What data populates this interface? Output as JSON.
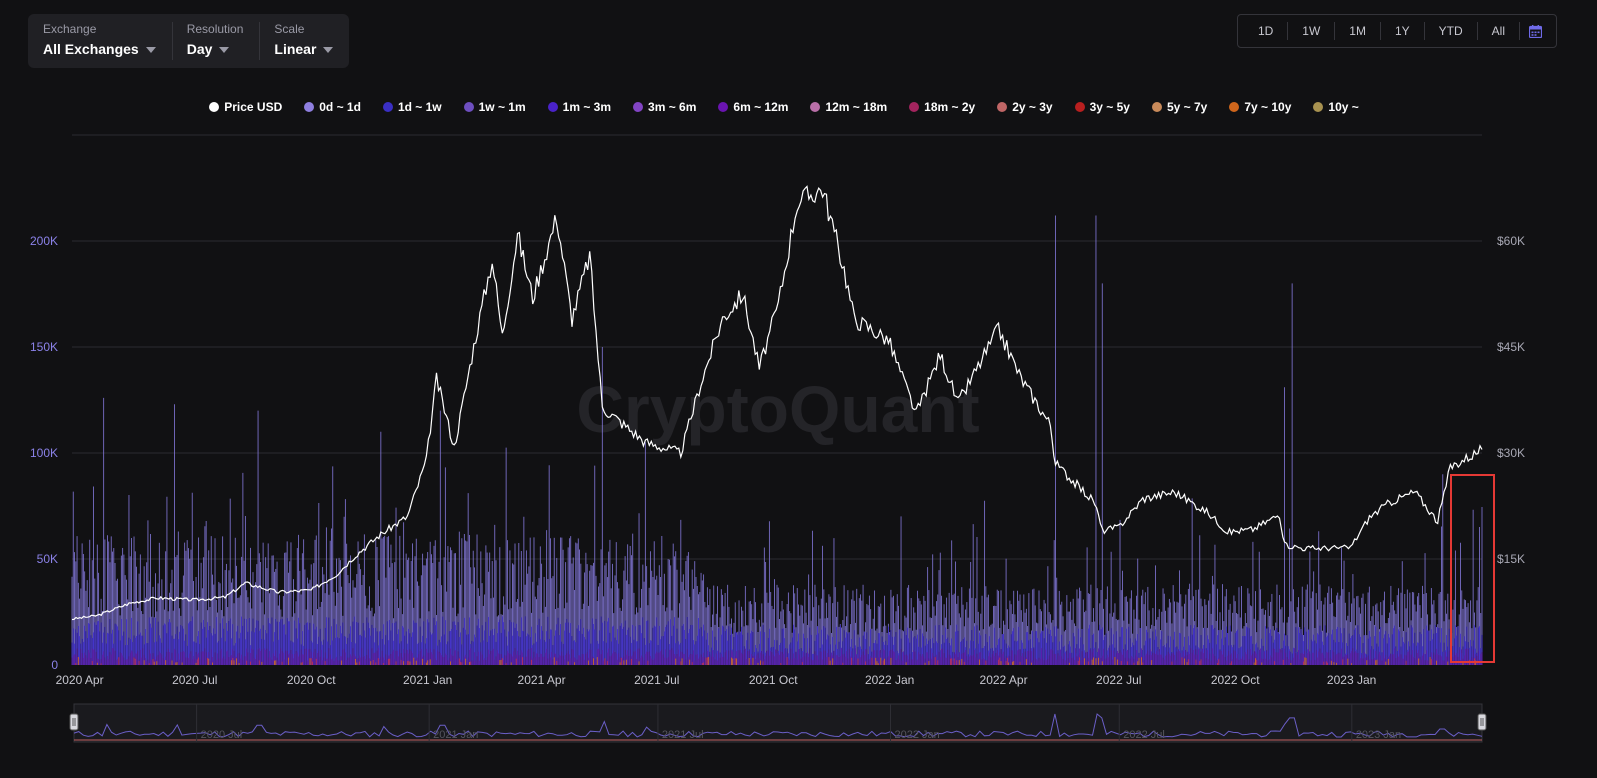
{
  "controls": {
    "exchange": {
      "label": "Exchange",
      "value": "All Exchanges"
    },
    "resolution": {
      "label": "Resolution",
      "value": "Day"
    },
    "scale": {
      "label": "Scale",
      "value": "Linear"
    }
  },
  "range_buttons": [
    "1D",
    "1W",
    "1M",
    "1Y",
    "YTD",
    "All"
  ],
  "calendar_icon": "calendar-icon",
  "watermark": "CryptoQuant",
  "colors": {
    "background": "#111113",
    "price_line": "#ffffff",
    "left_axis_text": "#8b82e8",
    "highlight_box": "#e53935"
  },
  "legend": [
    {
      "name": "Price USD",
      "color": "#ffffff"
    },
    {
      "name": "0d ~ 1d",
      "color": "#8f7fe0"
    },
    {
      "name": "1d ~ 1w",
      "color": "#3a2fc4"
    },
    {
      "name": "1w ~ 1m",
      "color": "#6e4fc0"
    },
    {
      "name": "1m ~ 3m",
      "color": "#4a22c9"
    },
    {
      "name": "3m ~ 6m",
      "color": "#8244c4"
    },
    {
      "name": "6m ~ 12m",
      "color": "#6a14b0"
    },
    {
      "name": "12m ~ 18m",
      "color": "#b96fa8"
    },
    {
      "name": "18m ~ 2y",
      "color": "#a3245e"
    },
    {
      "name": "2y ~ 3y",
      "color": "#c06666"
    },
    {
      "name": "3y ~ 5y",
      "color": "#b81f1f"
    },
    {
      "name": "5y ~ 7y",
      "color": "#c88a5a"
    },
    {
      "name": "7y ~ 10y",
      "color": "#d0661c"
    },
    {
      "name": "10y ~",
      "color": "#a89250"
    }
  ],
  "chart_data": {
    "type": "bar",
    "title": "",
    "x_tick_labels": [
      "2020 Apr",
      "2020 Jul",
      "2020 Oct",
      "2021 Jan",
      "2021 Apr",
      "2021 Jul",
      "2021 Oct",
      "2022 Jan",
      "2022 Apr",
      "2022 Jul",
      "2022 Oct",
      "2023 Jan"
    ],
    "xlim": [
      "2020-03-26",
      "2023-04-14"
    ],
    "left_axis": {
      "ticks": [
        "0",
        "50K",
        "100K",
        "150K",
        "200K"
      ],
      "ylim": [
        0,
        250000
      ]
    },
    "right_axis": {
      "ticks": [
        "$15K",
        "$30K",
        "$45K",
        "$60K"
      ],
      "ylim": [
        0,
        75000
      ]
    },
    "grid": true,
    "legend_position": "top-center",
    "price_usd": {
      "name": "Price USD",
      "points": [
        [
          "2020-03-26",
          6500
        ],
        [
          "2020-04-15",
          7000
        ],
        [
          "2020-05-10",
          8700
        ],
        [
          "2020-06-01",
          9500
        ],
        [
          "2020-07-01",
          9200
        ],
        [
          "2020-07-25",
          9600
        ],
        [
          "2020-08-10",
          11600
        ],
        [
          "2020-09-05",
          10300
        ],
        [
          "2020-10-01",
          10600
        ],
        [
          "2020-10-21",
          12800
        ],
        [
          "2020-11-05",
          15500
        ],
        [
          "2020-11-25",
          18500
        ],
        [
          "2020-12-16",
          21000
        ],
        [
          "2020-12-31",
          29000
        ],
        [
          "2021-01-08",
          40500
        ],
        [
          "2021-01-22",
          30800
        ],
        [
          "2021-02-08",
          46500
        ],
        [
          "2021-02-21",
          57500
        ],
        [
          "2021-03-01",
          46500
        ],
        [
          "2021-03-13",
          61000
        ],
        [
          "2021-03-25",
          52000
        ],
        [
          "2021-04-13",
          63500
        ],
        [
          "2021-04-25",
          49000
        ],
        [
          "2021-05-09",
          58000
        ],
        [
          "2021-05-19",
          36500
        ],
        [
          "2021-06-22",
          31500
        ],
        [
          "2021-07-20",
          30000
        ],
        [
          "2021-08-05",
          40000
        ],
        [
          "2021-08-22",
          49000
        ],
        [
          "2021-09-07",
          52500
        ],
        [
          "2021-09-20",
          42000
        ],
        [
          "2021-10-05",
          51000
        ],
        [
          "2021-10-20",
          65500
        ],
        [
          "2021-11-09",
          67500
        ],
        [
          "2021-11-26",
          56000
        ],
        [
          "2021-12-04",
          49000
        ],
        [
          "2021-12-31",
          46000
        ],
        [
          "2022-01-22",
          35500
        ],
        [
          "2022-02-10",
          44000
        ],
        [
          "2022-02-24",
          37000
        ],
        [
          "2022-03-28",
          47500
        ],
        [
          "2022-04-15",
          40500
        ],
        [
          "2022-05-08",
          34000
        ],
        [
          "2022-05-12",
          28500
        ],
        [
          "2022-06-12",
          23000
        ],
        [
          "2022-06-18",
          19000
        ],
        [
          "2022-07-01",
          19500
        ],
        [
          "2022-07-20",
          23500
        ],
        [
          "2022-08-14",
          24500
        ],
        [
          "2022-09-10",
          21500
        ],
        [
          "2022-09-25",
          18800
        ],
        [
          "2022-10-15",
          19200
        ],
        [
          "2022-11-05",
          21300
        ],
        [
          "2022-11-09",
          17000
        ],
        [
          "2022-11-25",
          16500
        ],
        [
          "2022-12-31",
          16600
        ],
        [
          "2023-01-15",
          20900
        ],
        [
          "2023-01-31",
          23000
        ],
        [
          "2023-02-20",
          24500
        ],
        [
          "2023-03-10",
          20300
        ],
        [
          "2023-03-20",
          28000
        ],
        [
          "2023-04-14",
          30500
        ]
      ]
    },
    "volume_spikes": {
      "name": "0d ~ 1d",
      "points": [
        [
          "2020-04-20",
          126000
        ],
        [
          "2020-06-15",
          123000
        ],
        [
          "2020-08-20",
          120000
        ],
        [
          "2020-11-25",
          110000
        ],
        [
          "2021-01-11",
          120000
        ],
        [
          "2021-05-19",
          150000
        ],
        [
          "2021-06-22",
          105000
        ],
        [
          "2022-05-12",
          212000
        ],
        [
          "2022-06-13",
          212000
        ],
        [
          "2022-06-18",
          180000
        ],
        [
          "2022-11-09",
          131000
        ],
        [
          "2022-11-15",
          180000
        ],
        [
          "2023-03-14",
          90000
        ]
      ]
    }
  },
  "navigator": {
    "labels": [
      "2020 Jul",
      "2021 Jan",
      "2021 Jul",
      "2022 Jan",
      "2022 Jul",
      "2023 Jan"
    ]
  }
}
